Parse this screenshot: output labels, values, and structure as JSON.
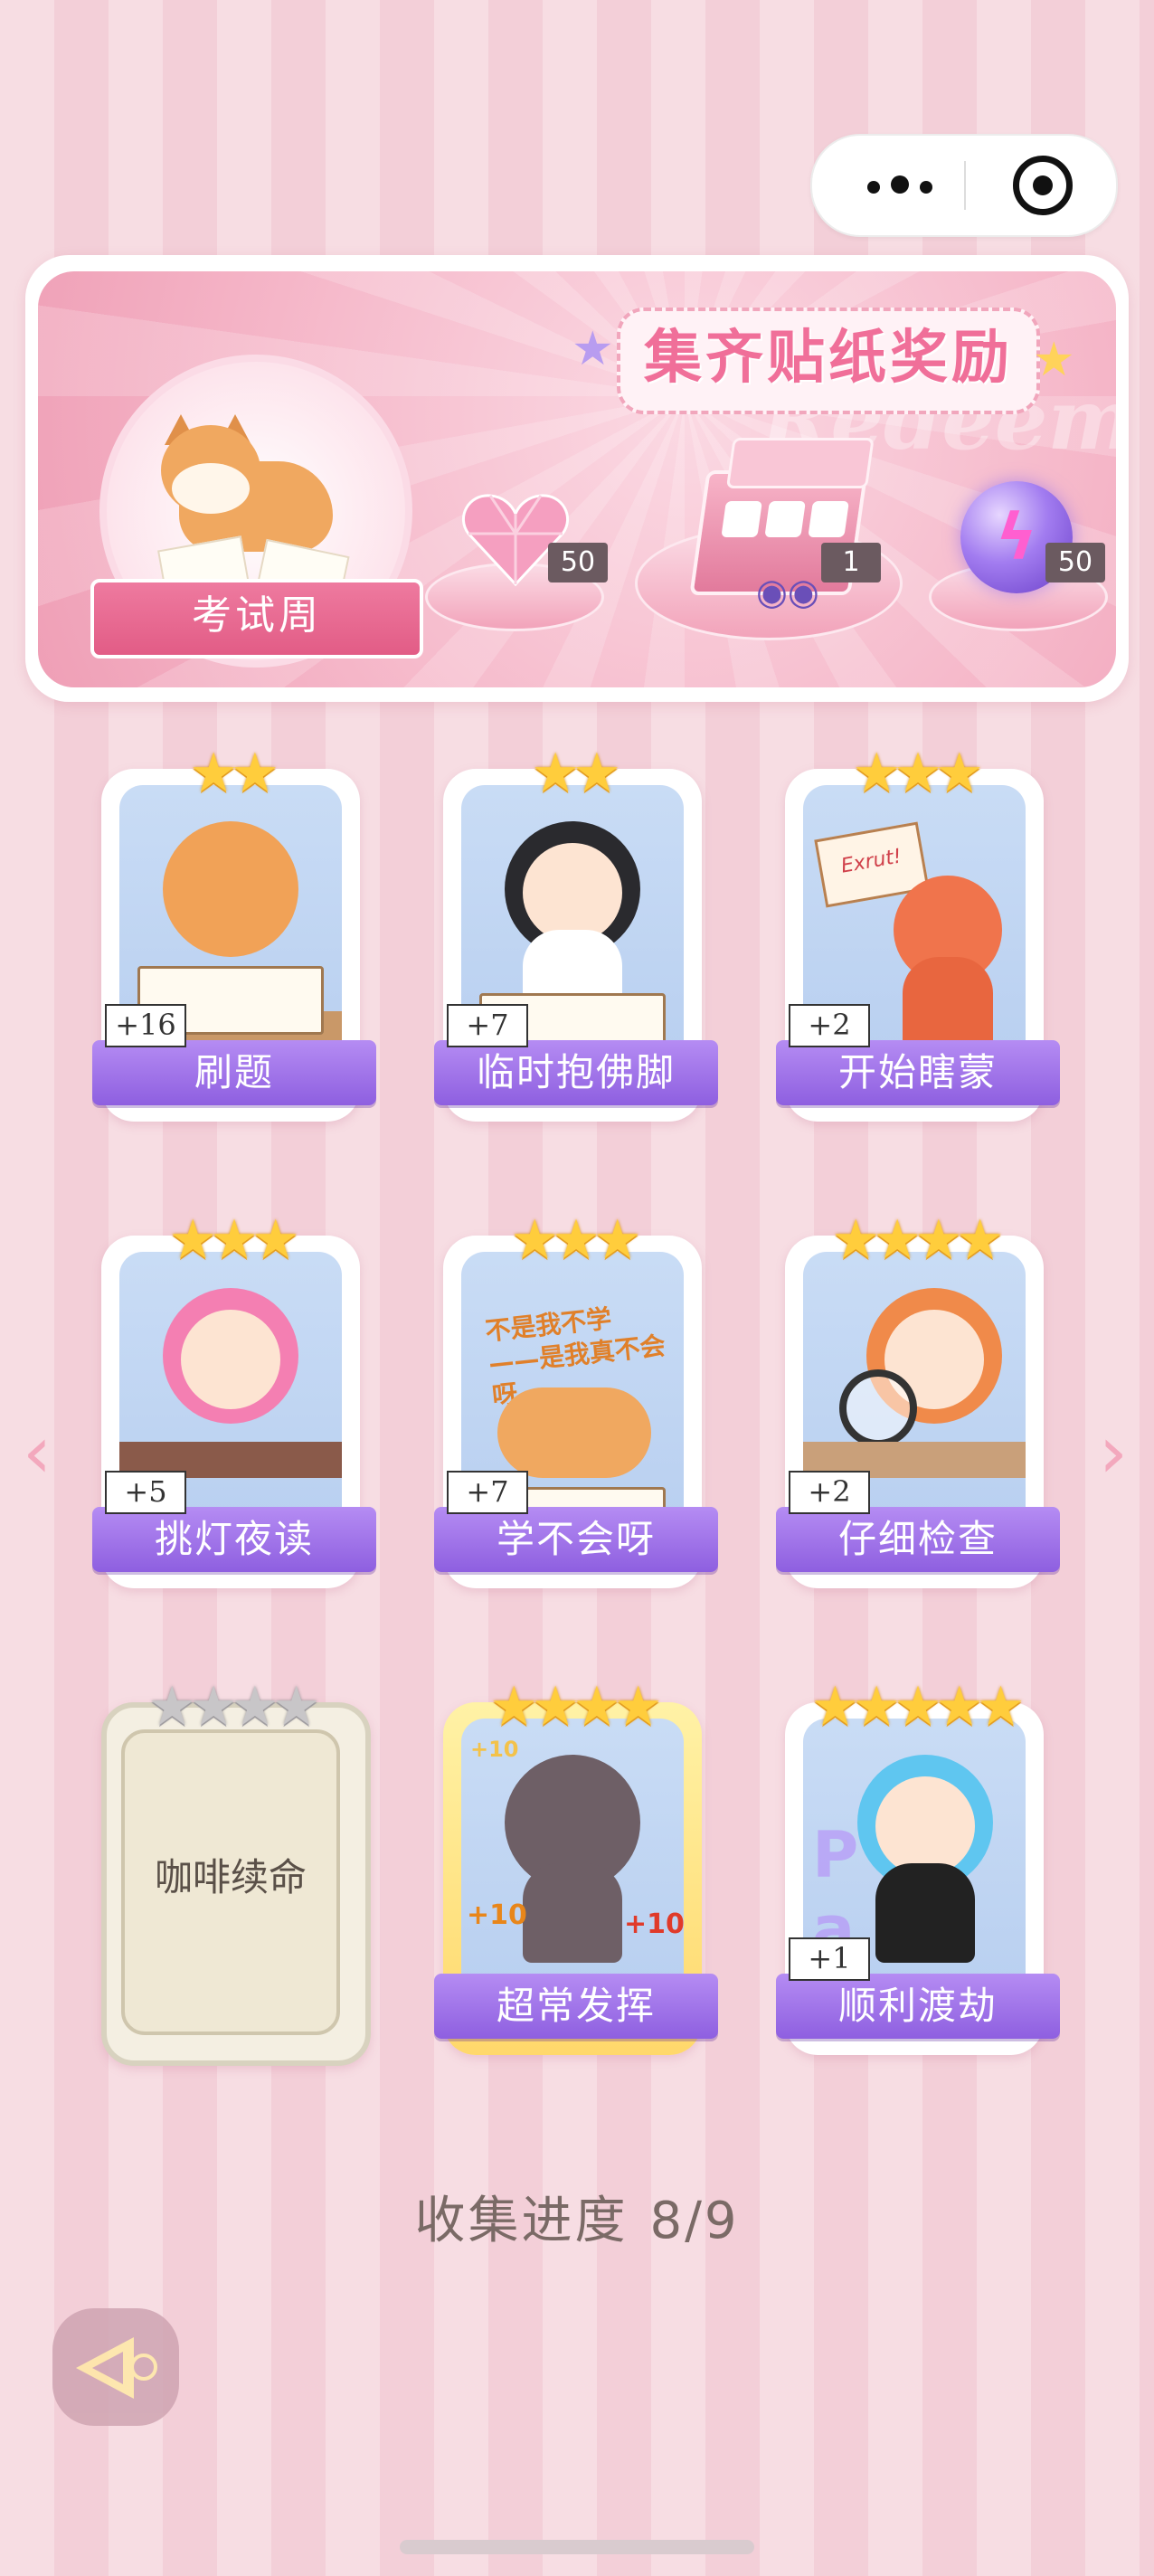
{
  "capsule": {
    "more_icon": "more-dots-icon",
    "close_icon": "target-icon"
  },
  "banner": {
    "title": "集齐贴纸奖励",
    "watermark": "Redeem",
    "badge": "考试周",
    "rewards": [
      {
        "icon": "pink-heart-gem-icon",
        "count": "50"
      },
      {
        "icon": "gift-box-icon",
        "count": "1"
      },
      {
        "icon": "purple-lightning-orb-icon",
        "count": "50"
      }
    ]
  },
  "cards": [
    {
      "name": "刷题",
      "stars": "★★",
      "plus": "+16",
      "locked": false
    },
    {
      "name": "临时抱佛脚",
      "stars": "★★",
      "plus": "+7",
      "locked": false
    },
    {
      "name": "开始瞎蒙",
      "stars": "★★★",
      "plus": "+2",
      "locked": false,
      "sign_text": "Exrut!"
    },
    {
      "name": "挑灯夜读",
      "stars": "★★★",
      "plus": "+5",
      "locked": false
    },
    {
      "name": "学不会呀",
      "stars": "★★★",
      "plus": "+7",
      "locked": false,
      "caption": "不是我不学\n——是我真不会呀"
    },
    {
      "name": "仔细检查",
      "stars": "★★★★",
      "plus": "+2",
      "locked": false
    },
    {
      "name": "咖啡续命",
      "stars": "★★★★",
      "plus": "",
      "locked": true
    },
    {
      "name": "超常发挥",
      "stars": "★★★★",
      "plus": "",
      "locked": false,
      "golden": true,
      "tags": [
        "+10",
        "+10",
        "+10"
      ]
    },
    {
      "name": "顺利渡劫",
      "stars": "★★★★★",
      "plus": "+1",
      "locked": false
    }
  ],
  "progress": {
    "label": "收集进度",
    "value": "8/9"
  },
  "colors": {
    "name_bar": "#8e5fe0",
    "title_pink": "#f06f99",
    "star_gold": "#ffcd3c"
  }
}
